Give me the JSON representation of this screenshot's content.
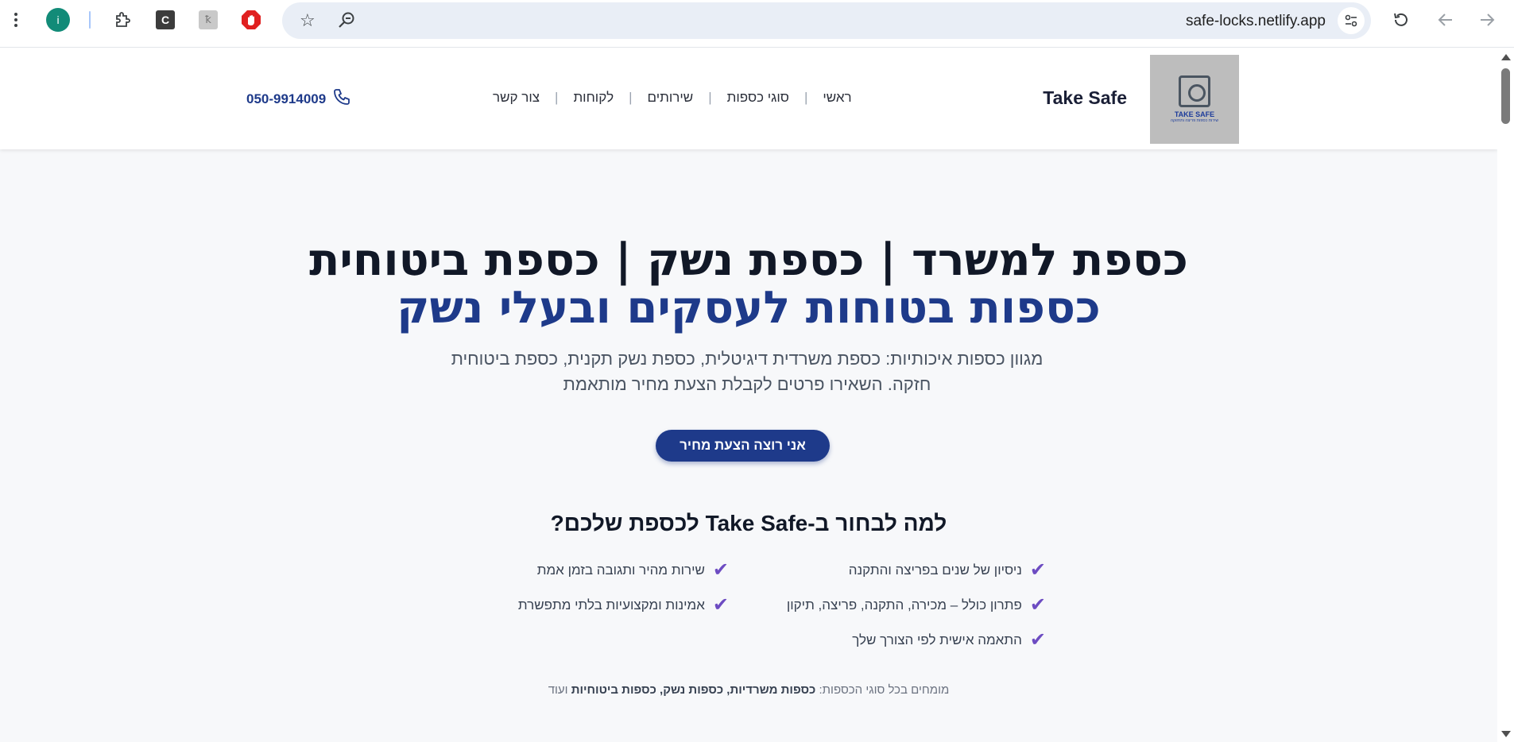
{
  "browser": {
    "profile_initial": "i",
    "ext_c_label": "C",
    "ext_h_label": "ꝁ",
    "url": "safe-locks.netlify.app"
  },
  "header": {
    "brand": "Take Safe",
    "logo_text": "TAKE SAFE",
    "logo_sub": "שירות כספות פריצה ותחזוקה",
    "nav": [
      "ראשי",
      "סוגי כספות",
      "שירותים",
      "לקוחות",
      "צור קשר"
    ],
    "phone": "050-9914009"
  },
  "hero": {
    "title_line1": "כספת למשרד | כספת נשק | כספת ביטוחית",
    "title_line2": "כספות בטוחות לעסקים ובעלי נשק",
    "lead": "מגוון כספות איכותיות: כספת משרדית דיגיטלית, כספת נשק תקנית, כספת ביטוחית חזקה. השאירו פרטים לקבלת הצעת מחיר מותאמת",
    "cta": "אני רוצה הצעת מחיר",
    "why_title": "למה לבחור ב-Take Safe לכספת שלכם?",
    "features_right": [
      "ניסיון של שנים בפריצה והתקנה",
      "פתרון כולל – מכירה, התקנה, פריצה, תיקון",
      "התאמה אישית לפי הצורך שלך"
    ],
    "features_left": [
      "שירות מהיר ותגובה בזמן אמת",
      "אמינות ומקצועיות בלתי מתפשרת"
    ],
    "footnote_prefix": "מומחים בכל סוגי הכספות: ",
    "footnote_bold": "כספות משרדיות, כספות נשק, כספות ביטוחיות",
    "footnote_suffix": " ועוד"
  },
  "colors": {
    "accent": "#1e3a8a",
    "check": "#6d4cc2",
    "heading": "#111827"
  }
}
